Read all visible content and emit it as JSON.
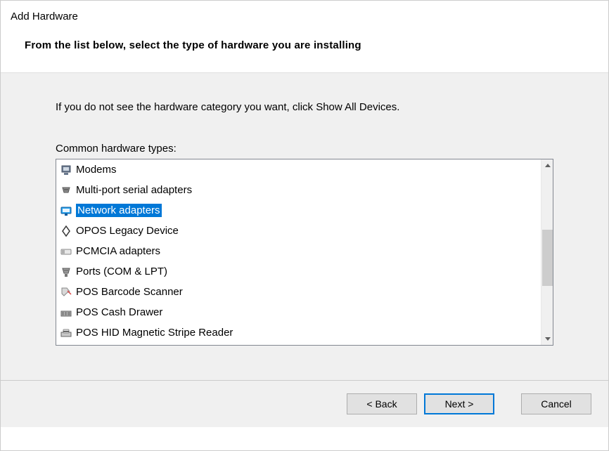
{
  "window": {
    "title": "Add Hardware"
  },
  "header": {
    "instruction": "From the list below, select the type of hardware you are installing"
  },
  "content": {
    "help_text": "If you do not see the hardware category you want, click Show All Devices.",
    "list_label": "Common hardware types:",
    "items": [
      {
        "icon": "modem-icon",
        "label": "Modems",
        "selected": false
      },
      {
        "icon": "serial-adapter-icon",
        "label": "Multi-port serial adapters",
        "selected": false
      },
      {
        "icon": "network-adapter-icon",
        "label": "Network adapters",
        "selected": true
      },
      {
        "icon": "opos-icon",
        "label": "OPOS Legacy Device",
        "selected": false
      },
      {
        "icon": "pcmcia-icon",
        "label": "PCMCIA adapters",
        "selected": false
      },
      {
        "icon": "ports-icon",
        "label": "Ports (COM & LPT)",
        "selected": false
      },
      {
        "icon": "barcode-scanner-icon",
        "label": "POS Barcode Scanner",
        "selected": false
      },
      {
        "icon": "cash-drawer-icon",
        "label": "POS Cash Drawer",
        "selected": false
      },
      {
        "icon": "magstripe-icon",
        "label": "POS HID Magnetic Stripe Reader",
        "selected": false
      }
    ]
  },
  "footer": {
    "back": "< Back",
    "next": "Next >",
    "cancel": "Cancel"
  }
}
